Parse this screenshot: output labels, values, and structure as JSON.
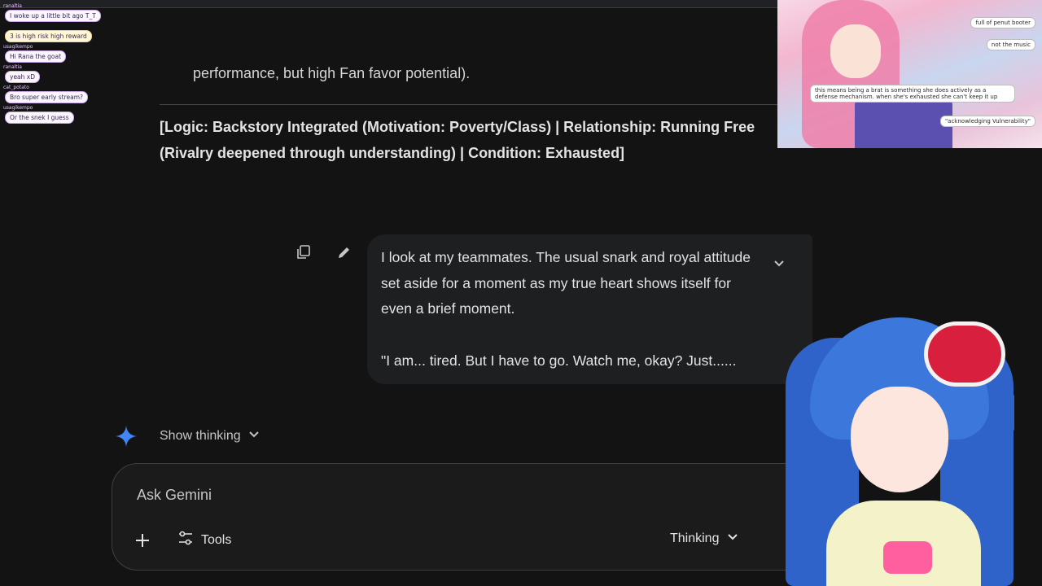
{
  "chat_overlay": {
    "messages": [
      {
        "user": "ranaltia",
        "text": "I woke up a little bit ago T_T",
        "style": "default"
      },
      {
        "user": "",
        "text": "3 is high risk high reward",
        "style": "yellow"
      },
      {
        "user": "usagikempo",
        "text": "Hi Rana the goat",
        "style": "default"
      },
      {
        "user": "ranaltia",
        "text": "yeah xD",
        "style": "default"
      },
      {
        "user": "cat_potato",
        "text": "Bro super early stream?",
        "style": "default"
      },
      {
        "user": "usagikempo",
        "text": "Or the snek I guess",
        "style": "default"
      }
    ]
  },
  "conversation": {
    "prev_response_tail": "performance, but high Fan favor potential).",
    "logic_line": "[Logic: Backstory Integrated (Motivation: Poverty/Class) | Relationship: Running Free (Rivalry deepened through understanding) | Condition: Exhausted]",
    "user_message": {
      "line1": "I look at my teammates. The usual snark and royal attitude set aside for a moment as my true heart shows itself for even a brief moment.",
      "line2": "\"I am... tired. But I have to go. Watch me, okay? Just......"
    },
    "show_thinking_label": "Show thinking"
  },
  "input": {
    "placeholder": "Ask Gemini",
    "tools_label": "Tools",
    "mode_label": "Thinking"
  },
  "webcam_top": {
    "bubbles": [
      "full of penut booter",
      "not the music",
      "this means being a brat is something she does actively as a defense mechanism. when she's exhausted she can't keep it up",
      "\"acknowledging Vulnerability\""
    ]
  },
  "colors": {
    "background": "#131314",
    "bubble": "#1e1f20",
    "accent_sparkle": "#4285f4",
    "text": "#e3e3e3"
  }
}
